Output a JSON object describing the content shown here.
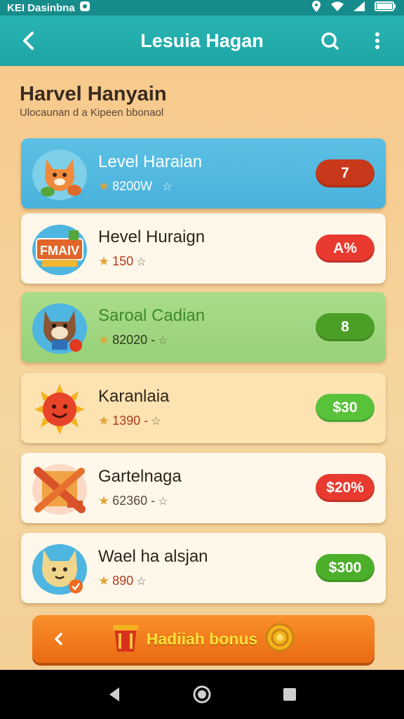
{
  "status_bar": {
    "left_text": "ΚΕΙ Dasinbna",
    "icons": [
      "notification-icon",
      "location-icon",
      "wifi-icon",
      "signal-icon",
      "battery-icon"
    ]
  },
  "app_bar": {
    "title": "Lesuia Hagan",
    "icons": [
      "back-arrow-icon",
      "search-icon",
      "more-vertical-icon"
    ]
  },
  "header": {
    "title": "Harvel Hanyain",
    "subtitle": "Ulocaunan d a Kipeen bbonaol"
  },
  "items": [
    {
      "name": "Level Haraian",
      "score": "8200W",
      "badge": "7",
      "theme": "blue",
      "thumb": "fox-mascot"
    },
    {
      "name": "Hevel Huraign",
      "score": "150",
      "badge": "A%",
      "theme": "white",
      "thumb": "fmaiv-sign"
    },
    {
      "name": "Saroal Cadian",
      "score": "82020 -",
      "badge": "8",
      "theme": "green",
      "thumb": "dog-mascot"
    },
    {
      "name": "Karanlaia",
      "score": "1390 -",
      "badge": "$30",
      "theme": "peach",
      "thumb": "sun-face"
    },
    {
      "name": "Gartelnaga",
      "score": "62360 -",
      "badge": "$20%",
      "theme": "white",
      "thumb": "crossed-planks"
    },
    {
      "name": "Wael ha alsjan",
      "score": "890",
      "badge": "$300",
      "theme": "white",
      "thumb": "cat-mascot"
    }
  ],
  "bonus": {
    "label": "Hadiiah bonus",
    "icons": [
      "chevron-left-icon",
      "gift-bucket-icon",
      "coin-icon"
    ]
  },
  "nav_bar": {
    "icons": [
      "back-triangle-icon",
      "home-circle-icon",
      "recents-square-icon"
    ]
  },
  "colors": {
    "teal": "#1fa6a6",
    "badge_dark_red": "#c8381a",
    "badge_red": "#e83a2f",
    "badge_green": "#4caf2a",
    "badge_lime": "#58c23a",
    "bonus_orange": "#f07c1a",
    "bonus_text": "#ffe13a"
  }
}
